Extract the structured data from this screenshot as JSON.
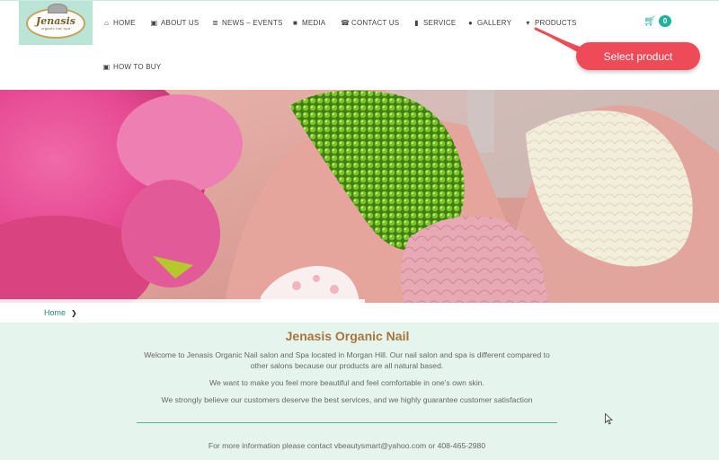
{
  "logo": {
    "name": "Jenasis",
    "tagline": "organic nail spa"
  },
  "nav": {
    "home": "HOME",
    "about": "ABOUT US",
    "news": "NEWS – EVENTS",
    "media": "MEDIA",
    "contact": "CONTACT US",
    "service": "SERVICE",
    "gallery": "GALLERY",
    "products": "PRODUCTS",
    "how_to_buy": "HOW TO BUY"
  },
  "icons": {
    "home": "home-icon",
    "about": "image-icon",
    "news": "newspaper-icon",
    "media": "video-camera-icon",
    "contact": "phone-icon",
    "service": "bar-chart-icon",
    "gallery": "globe-icon",
    "products": "shopping-cart-icon",
    "how_to_buy": "image-icon"
  },
  "cart": {
    "count": "0"
  },
  "callout": {
    "text": "Select product"
  },
  "breadcrumb": {
    "home": "Home"
  },
  "main": {
    "title": "Jenasis Organic Nail",
    "p1": "Welcome to Jenasis Organic Nail salon and Spa located in Morgan Hill. Our nail salon and spa is different compared to other salons because our products are all natural based.",
    "p2": "We want to make you feel more beautiful and feel comfortable in one’s own skin.",
    "p3": "We strongly believe our customers deserve the best services, and we highly guarantee customer satisfaction",
    "contact": "For more information please contact vbeautysmart@yahoo.com or 408-465-2980"
  },
  "colors": {
    "accent": "#20b29e",
    "callout": "#ef4a58",
    "title": "#a8743c",
    "content_bg": "#e6f4ee",
    "logo_bg": "#b9e4d6"
  }
}
